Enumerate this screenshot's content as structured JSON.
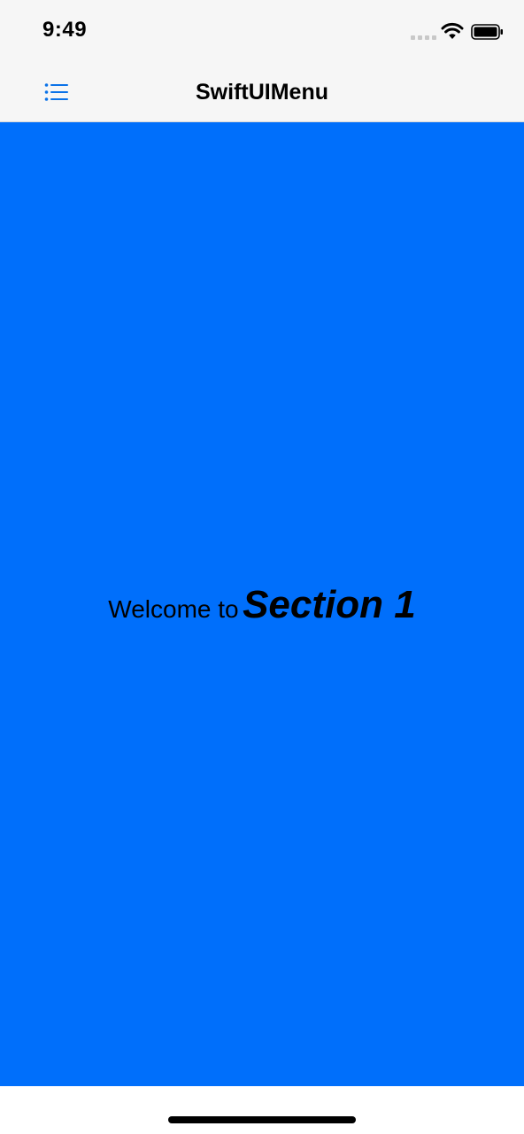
{
  "status_bar": {
    "time": "9:49",
    "wifi_icon": "wifi-icon",
    "battery_icon": "battery-icon",
    "cellular_icon": "cellular-signal-icon"
  },
  "nav_bar": {
    "title": "SwiftUIMenu",
    "menu_icon": "list-icon"
  },
  "content": {
    "welcome_prefix": "Welcome to",
    "section_name": "Section 1"
  },
  "colors": {
    "accent": "#0a72e8",
    "content_background": "#006ffb",
    "bar_background": "#f6f6f6"
  }
}
